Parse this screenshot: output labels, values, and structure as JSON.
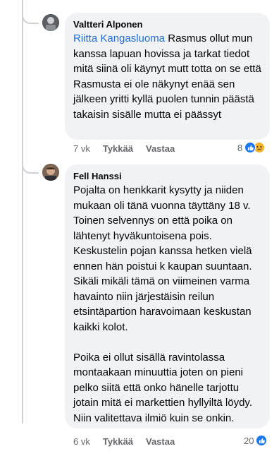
{
  "comments": [
    {
      "author": "Valtteri Alponen",
      "mention": "Riitta Kangasluoma",
      "text": " Rasmus ollut mun kanssa lapuan hovissa ja tarkat tiedot mitä siinä oli käynyt mutt totta on se että Rasmusta ei ole näkynyt enää sen jälkeen yritti kyllä puolen tunnin päästä takaisin sisälle mutta ei päässyt",
      "time": "7 vk",
      "like_label": "Tykkää",
      "reply_label": "Vastaa",
      "reaction_count": "8",
      "reactions": [
        "like-icon",
        "sad-icon"
      ]
    },
    {
      "author": "Fell Hanssi",
      "text": "Pojalta on henkkarit kysytty ja niiden mukaan oli tänä vuonna täyttäny 18 v. Toinen selvennys on että poika on lähtenyt hyväkuntoisena pois. Keskustelin pojan kanssa hetken vielä ennen hän poistui k kaupan suuntaan. Sikäli mikäli tämä on viimeinen varma havainto niin järjestäisin reilun etsintäpartion haravoimaan keskustan kaikki kolot.\n\nPoika ei ollut sisällä ravintolassa montaakaan minuuttia joten on pieni pelko siitä että onko hänelle tarjottu jotain mitä ei markettien hyllyiltä löydy. Niin valitettava ilmiö kuin se onkin.",
      "time": "6 vk",
      "like_label": "Tykkää",
      "reply_label": "Vastaa",
      "reaction_count": "20",
      "reactions": [
        "like-icon"
      ]
    }
  ],
  "colors": {
    "bubble": "#f0f2f5",
    "mention": "#216fdb",
    "meta": "#65676b",
    "like": "#1877f2",
    "sad": "#f7b125"
  }
}
